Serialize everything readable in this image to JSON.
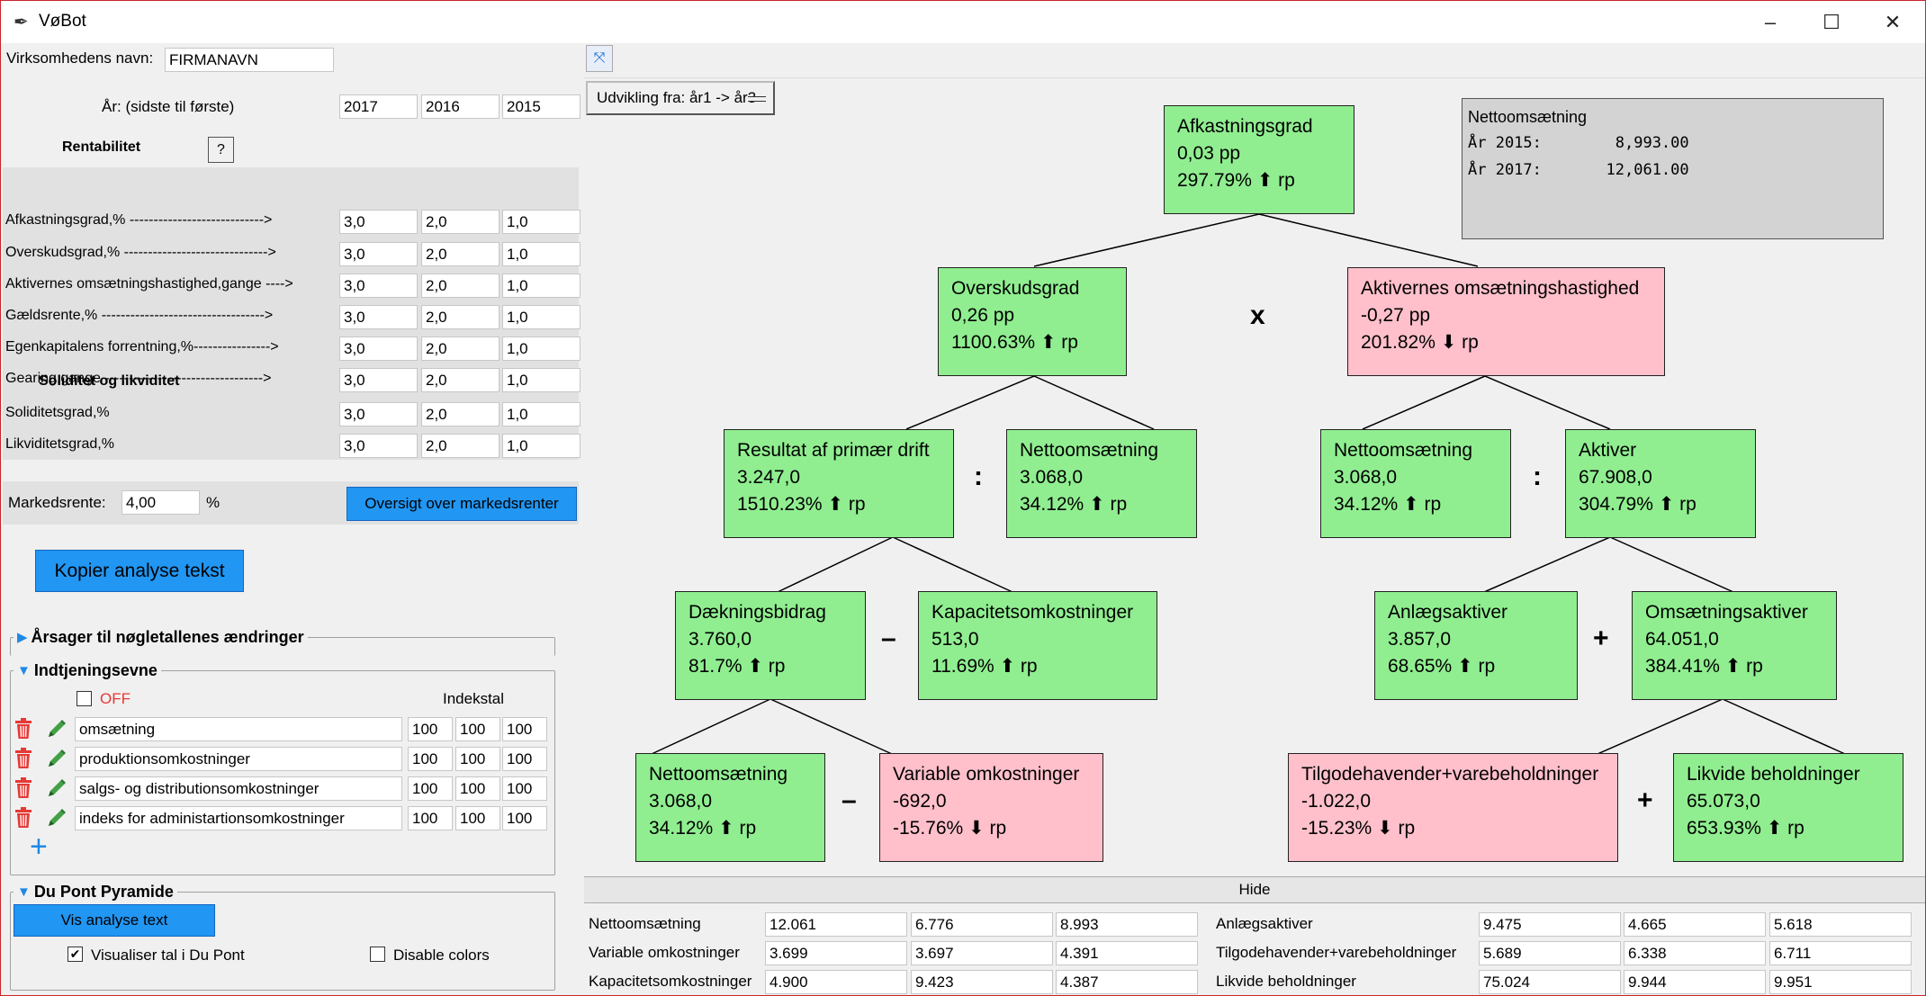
{
  "window": {
    "title": "VøBot",
    "controls": {
      "minimize": "–",
      "maximize": "☐",
      "close": "✕"
    }
  },
  "left": {
    "company_label": "Virksomhedens navn:",
    "company_value": "FIRMANAVN",
    "year_label": "År: (sidste til første)",
    "years": [
      "2017",
      "2016",
      "2015"
    ],
    "profitability_title": "Rentabilitet",
    "help_label": "?",
    "profitability_rows": [
      {
        "label": "Afkastningsgrad,%  ---------------------------->",
        "v": [
          "3,0",
          "2,0",
          "1,0"
        ]
      },
      {
        "label": "Overskudsgrad,% ------------------------------>",
        "v": [
          "3,0",
          "2,0",
          "1,0"
        ]
      },
      {
        "label": "Aktivernes omsætningshastighed,gange ---->",
        "v": [
          "3,0",
          "2,0",
          "1,0"
        ]
      },
      {
        "label": "Gældsrente,%  ---------------------------------->",
        "v": [
          "3,0",
          "2,0",
          "1,0"
        ]
      },
      {
        "label": "Egenkapitalens forrentning,%---------------->",
        "v": [
          "3,0",
          "2,0",
          "1,0"
        ]
      },
      {
        "label": "Gearing,gange --------------------------------->",
        "v": [
          "3,0",
          "2,0",
          "1,0"
        ]
      }
    ],
    "solidity_title": "Soliditet og likviditet",
    "solidity_rows": [
      {
        "label": "Soliditetsgrad,%",
        "v": [
          "3,0",
          "2,0",
          "1,0"
        ]
      },
      {
        "label": "Likviditetsgrad,%",
        "v": [
          "3,0",
          "2,0",
          "1,0"
        ]
      }
    ],
    "market_label": "Markedsrente:",
    "market_value": "4,00",
    "market_unit": "%",
    "market_button": "Oversigt over markedsrenter",
    "copy_button": "Kopier analyse tekst",
    "causes_title": "Årsager til nøgletallenes ændringer",
    "earning_title": "Indtjeningsevne",
    "off_label": "OFF",
    "index_label": "Indekstal",
    "index_rows": [
      {
        "name": "omsætning",
        "v": [
          "100",
          "100",
          "100"
        ]
      },
      {
        "name": "produktionsomkostninger",
        "v": [
          "100",
          "100",
          "100"
        ]
      },
      {
        "name": "salgs- og distributionsomkostninger",
        "v": [
          "100",
          "100",
          "100"
        ]
      },
      {
        "name": "indeks for administartionsomkostninger",
        "v": [
          "100",
          "100",
          "100"
        ]
      }
    ],
    "add_label": "+",
    "dupont_title": "Du Pont Pyramide",
    "vis_button": "Vis analyse text",
    "visualize_label": "Visualiser tal i Du Pont",
    "visualize_checked": "✔",
    "disable_colors_label": "Disable colors"
  },
  "right": {
    "dropdown": "Udvikling fra: år1 -> år3",
    "info": {
      "title": "Nettoomsætning",
      "line1": "År 2015:        8,993.00",
      "line2": "År 2017:       12,061.00"
    },
    "nodes": {
      "afkast": {
        "name": "Afkastningsgrad",
        "val": "0,03 pp",
        "pct": "297.79% ⬆ rp"
      },
      "overskud": {
        "name": "Overskudsgrad",
        "val": "0,26 pp",
        "pct": "1100.63% ⬆ rp"
      },
      "aktoms": {
        "name": "Aktivernes omsætningshastighed",
        "val": "-0,27 pp",
        "pct": "201.82% ⬇ rp"
      },
      "resultat": {
        "name": "Resultat af primær drift",
        "val": "3.247,0",
        "pct": "1510.23% ⬆ rp"
      },
      "netto1": {
        "name": "Nettoomsætning",
        "val": "3.068,0",
        "pct": "34.12% ⬆ rp"
      },
      "netto2": {
        "name": "Nettoomsætning",
        "val": "3.068,0",
        "pct": "34.12% ⬆ rp"
      },
      "aktiver": {
        "name": "Aktiver",
        "val": "67.908,0",
        "pct": "304.79% ⬆ rp"
      },
      "daekning": {
        "name": "Dækningsbidrag",
        "val": "3.760,0",
        "pct": "81.7% ⬆ rp"
      },
      "kapacitet": {
        "name": "Kapacitetsomkostninger",
        "val": "513,0",
        "pct": "11.69% ⬆ rp"
      },
      "anlaeg": {
        "name": "Anlægsaktiver",
        "val": "3.857,0",
        "pct": "68.65% ⬆ rp"
      },
      "omsaktiver": {
        "name": "Omsætningsaktiver",
        "val": "64.051,0",
        "pct": "384.41% ⬆ rp"
      },
      "netto3": {
        "name": "Nettoomsætning",
        "val": "3.068,0",
        "pct": "34.12% ⬆ rp"
      },
      "variable": {
        "name": "Variable omkostninger",
        "val": "-692,0",
        "pct": "-15.76% ⬇ rp"
      },
      "tilgode": {
        "name": "Tilgodehavender+varebeholdninger",
        "val": "-1.022,0",
        "pct": "-15.23% ⬇ rp"
      },
      "likvide": {
        "name": "Likvide beholdninger",
        "val": "65.073,0",
        "pct": "653.93% ⬆ rp"
      }
    },
    "ops": {
      "x": "x",
      "div1": ":",
      "div2": ":",
      "minus1": "–",
      "plus1": "+",
      "minus2": "–",
      "plus2": "+"
    },
    "hide_label": "Hide",
    "grid_left": [
      {
        "label": "Nettoomsætning",
        "v": [
          "12.061",
          "6.776",
          "8.993"
        ]
      },
      {
        "label": "Variable omkostninger",
        "v": [
          "3.699",
          "3.697",
          "4.391"
        ]
      },
      {
        "label": "Kapacitetsomkostninger",
        "v": [
          "4.900",
          "9.423",
          "4.387"
        ]
      }
    ],
    "grid_right": [
      {
        "label": "Anlægsaktiver",
        "v": [
          "9.475",
          "4.665",
          "5.618"
        ]
      },
      {
        "label": "Tilgodehavender+varebeholdninger",
        "v": [
          "5.689",
          "6.338",
          "6.711"
        ]
      },
      {
        "label": "Likvide beholdninger",
        "v": [
          "75.024",
          "9.944",
          "9.951"
        ]
      }
    ]
  },
  "colors": {
    "green": "#90ee90",
    "pink": "#ffc0cb",
    "blue_button": "#2196f3",
    "accent_red": "#e53935"
  }
}
